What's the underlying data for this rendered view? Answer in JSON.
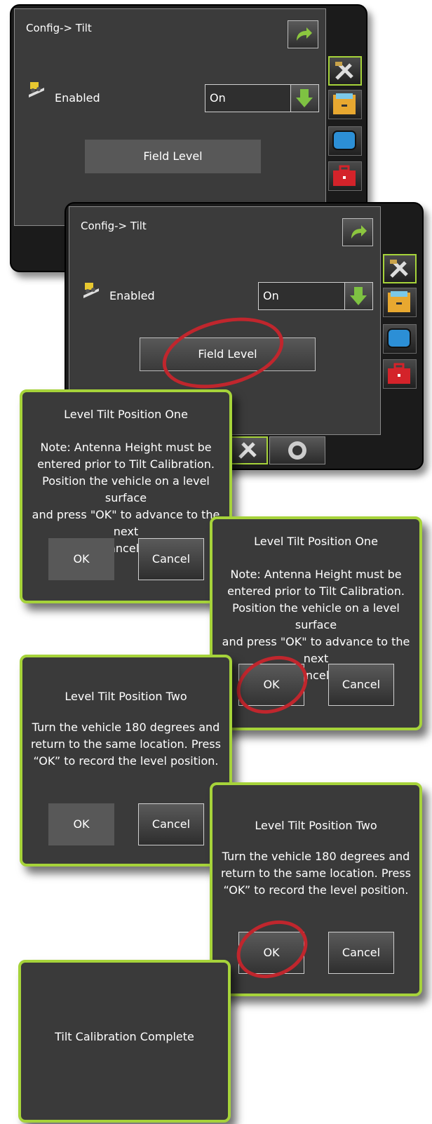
{
  "screen1": {
    "title": "Config-> Tilt",
    "enabled_label": "Enabled",
    "select_value": "On",
    "field_level": "Field Level"
  },
  "screen2": {
    "title": "Config-> Tilt",
    "enabled_label": "Enabled",
    "select_value": "On",
    "field_level": "Field Level"
  },
  "dialog_one": {
    "title": "Level Tilt Position One",
    "lines": [
      "Note: Antenna Height must be",
      "entered prior to Tilt Calibration.",
      "Position the vehicle on a level surface",
      "and press \"OK\" to advance to the next",
      "step, or \"Cancel\" to cancel."
    ],
    "ok": "OK",
    "cancel": "Cancel"
  },
  "dialog_two": {
    "title": "Level Tilt Position Two",
    "lines": [
      "Turn the vehicle 180 degrees and",
      "return to the same location.  Press",
      "“OK” to record the level position."
    ],
    "ok": "OK",
    "cancel": "Cancel"
  },
  "dialog_complete": {
    "message": "Tilt Calibration Complete"
  },
  "icons": {
    "accent": "#a6d33a",
    "highlight_ring": "#c0262d"
  }
}
